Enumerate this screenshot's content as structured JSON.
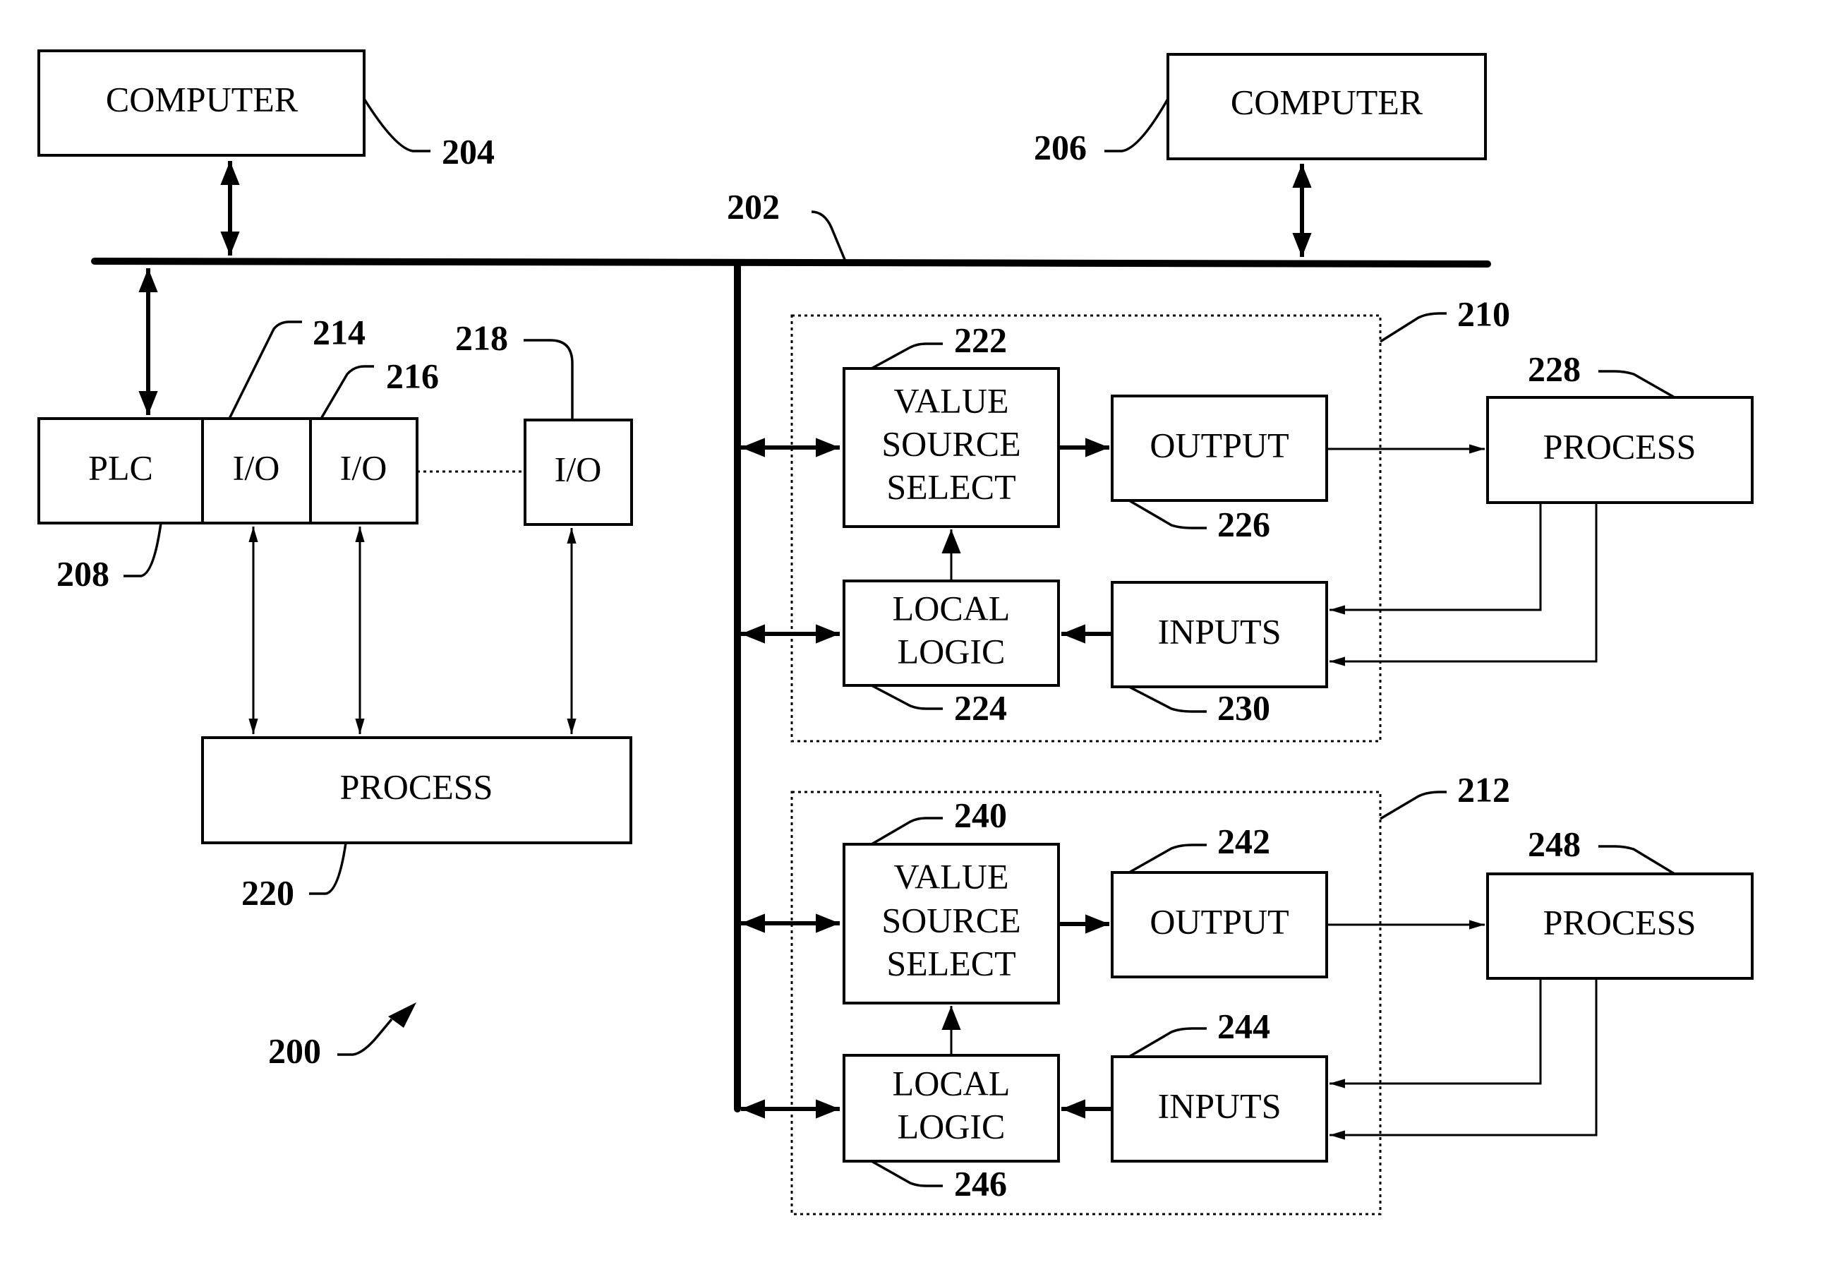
{
  "figure": {
    "system_ref": "200",
    "bus": {
      "ref": "202"
    },
    "computers": [
      {
        "ref": "204",
        "label": "COMPUTER"
      },
      {
        "ref": "206",
        "label": "COMPUTER"
      }
    ],
    "plc_rack": {
      "plc": {
        "ref": "208",
        "label": "PLC"
      },
      "io_modules": [
        {
          "ref": "214",
          "label": "I/O"
        },
        {
          "ref": "216",
          "label": "I/O"
        },
        {
          "ref": "218",
          "label": "I/O"
        }
      ],
      "process": {
        "ref": "220",
        "label": "PROCESS"
      }
    },
    "field_devices": [
      {
        "ref": "210",
        "value_source_select": {
          "ref": "222",
          "lines": [
            "VALUE",
            "SOURCE",
            "SELECT"
          ]
        },
        "local_logic": {
          "ref": "224",
          "lines": [
            "LOCAL",
            "LOGIC"
          ]
        },
        "output": {
          "ref": "226",
          "label": "OUTPUT"
        },
        "inputs": {
          "ref": "230",
          "label": "INPUTS"
        },
        "process": {
          "ref": "228",
          "label": "PROCESS"
        }
      },
      {
        "ref": "212",
        "value_source_select": {
          "ref": "240",
          "lines": [
            "VALUE",
            "SOURCE",
            "SELECT"
          ]
        },
        "local_logic": {
          "ref": "246",
          "lines": [
            "LOCAL",
            "LOGIC"
          ]
        },
        "output": {
          "ref": "242",
          "label": "OUTPUT"
        },
        "inputs": {
          "ref": "244",
          "label": "INPUTS"
        },
        "process": {
          "ref": "248",
          "label": "PROCESS"
        }
      }
    ]
  }
}
